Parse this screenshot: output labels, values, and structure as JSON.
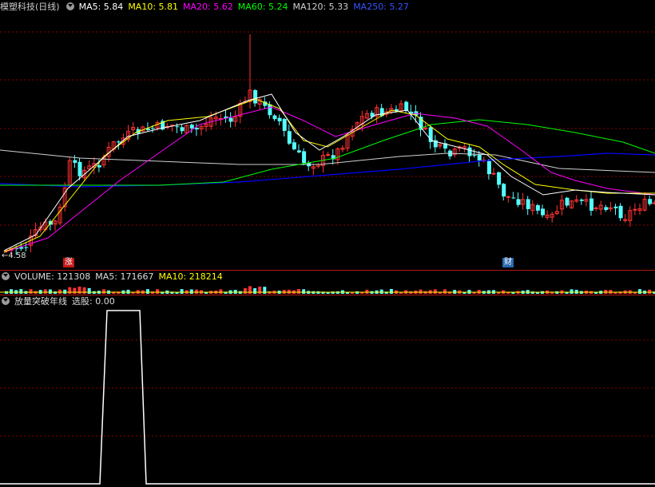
{
  "main_panel": {
    "title": "模塑科技(日线)",
    "indicators": [
      {
        "label": "MA5: 5.84",
        "color": "#ffffff"
      },
      {
        "label": "MA10: 5.81",
        "color": "#ffff00"
      },
      {
        "label": "MA20: 5.62",
        "color": "#ff00ff"
      },
      {
        "label": "MA60: 5.24",
        "color": "#00ff00"
      },
      {
        "label": "MA120: 5.33",
        "color": "#d0d0d0"
      },
      {
        "label": "MA250: 5.27",
        "color": "#3355ff"
      }
    ],
    "low_price_label": "4.58",
    "badge_up": "涨",
    "badge_fin": "财"
  },
  "volume_panel": {
    "label": "VOLUME: 121308",
    "ma5": "MA5: 171667",
    "ma10": "MA10: 218214"
  },
  "indicator_panel": {
    "name": "放量突破年线",
    "value_label": "选股: 0.00"
  },
  "colors": {
    "up": "#ff3232",
    "down": "#54ffff",
    "grid": "#8b0000",
    "ma5": "#ffffff",
    "ma10": "#ffff00",
    "ma20": "#ff00ff",
    "ma60": "#00ff00",
    "ma120": "#d0d0d0",
    "ma250": "#0000ff"
  }
}
